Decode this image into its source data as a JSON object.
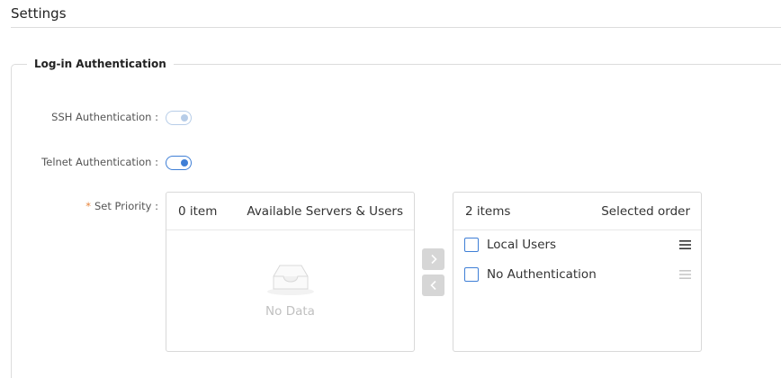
{
  "page": {
    "title": "Settings"
  },
  "section": {
    "legend": "Log-in Authentication"
  },
  "ssh": {
    "label": "SSH Authentication :",
    "enabled": true,
    "disabled": true
  },
  "telnet": {
    "label": "Telnet Authentication :",
    "enabled": true,
    "disabled": false
  },
  "priority": {
    "required_mark": "*",
    "label": "Set Priority :",
    "available": {
      "count_label": "0 item",
      "title": "Available Servers & Users",
      "empty_text": "No Data"
    },
    "selected": {
      "count_label": "2 items",
      "title": "Selected order",
      "items": [
        {
          "label": "Local Users",
          "checked": false
        },
        {
          "label": "No Authentication",
          "checked": false
        }
      ]
    }
  },
  "icons": {
    "move_right": "chevron-right-icon",
    "move_left": "chevron-left-icon",
    "drag": "drag-handle-icon",
    "empty": "empty-inbox-icon"
  },
  "colors": {
    "accent": "#3f7fd6",
    "required": "#e8843c",
    "disabled_button": "#d6d6d6"
  }
}
